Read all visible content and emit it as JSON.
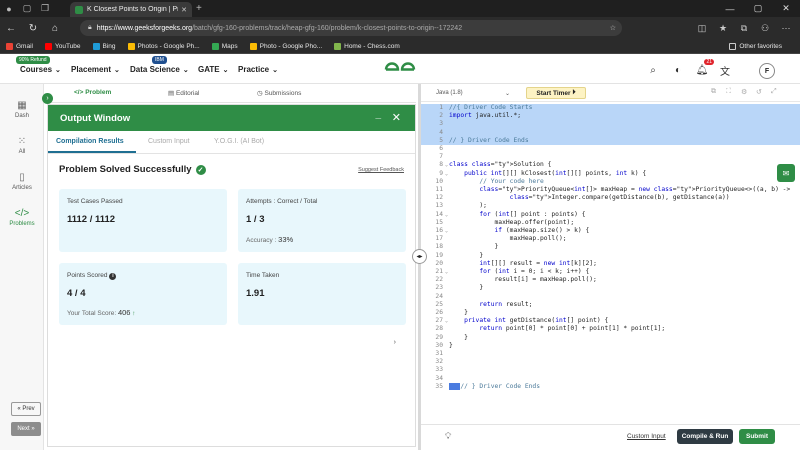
{
  "browser": {
    "tab_title": "K Closest Points to Origin | Practic",
    "url_host": "https://www.geeksforgeeks.org",
    "url_path": "/batch/gfg-160-problems/track/heap-gfg-160/problem/k-closest-points-to-origin--172242",
    "bookmarks": [
      {
        "label": "Gmail",
        "color": "#ea4335"
      },
      {
        "label": "YouTube",
        "color": "#ff0000"
      },
      {
        "label": "Bing",
        "color": "#1f9bd7"
      },
      {
        "label": "Photos - Google Ph...",
        "color": "#fbbc05"
      },
      {
        "label": "Maps",
        "color": "#34a853"
      },
      {
        "label": "Photo - Google Pho...",
        "color": "#fbbc05"
      },
      {
        "label": "Home - Chess.com",
        "color": "#81b64c"
      }
    ],
    "other_favorites": "Other favorites"
  },
  "header": {
    "courses": "Courses",
    "courses_badge": "90% Refund",
    "placement": "Placement",
    "data_science": "Data Science",
    "data_science_badge": "IBM",
    "gate": "GATE",
    "practice": "Practice",
    "notification_count": "21",
    "avatar_letter": "F"
  },
  "sidebar": {
    "items": [
      "Dash",
      "All",
      "Articles",
      "Problems"
    ],
    "prev": "« Prev",
    "next": "Next »"
  },
  "problem_tabs": [
    "Problem",
    "Editorial",
    "Submissions"
  ],
  "output": {
    "title": "Output Window",
    "tabs": [
      "Compilation Results",
      "Custom Input",
      "Y.O.G.I. (AI Bot)"
    ],
    "status": "Problem Solved Successfully",
    "suggest": "Suggest Feedback",
    "test_cases_label": "Test Cases Passed",
    "test_cases_value": "1112 / 1112",
    "attempts_label": "Attempts : Correct / Total",
    "attempts_value": "1 / 3",
    "accuracy_label": "Accuracy :",
    "accuracy_value": "33%",
    "points_label": "Points Scored",
    "points_value": "4 / 4",
    "total_score_label": "Your Total Score:",
    "total_score_value": "406",
    "time_label": "Time Taken",
    "time_value": "1.91"
  },
  "editor": {
    "language": "Java (1.8)",
    "timer": "Start Timer",
    "lines": [
      "//{ Driver Code Starts",
      "import java.util.*;",
      "",
      "",
      "// } Driver Code Ends",
      "",
      "",
      "class Solution {",
      "    public int[][] kClosest(int[][] points, int k) {",
      "        // Your code here",
      "        PriorityQueue<int[]> maxHeap = new PriorityQueue<>((a, b) ->",
      "                Integer.compare(getDistance(b), getDistance(a))",
      "        );",
      "        for (int[] point : points) {",
      "            maxHeap.offer(point);",
      "            if (maxHeap.size() > k) {",
      "                maxHeap.poll();",
      "            }",
      "        }",
      "        int[][] result = new int[k][2];",
      "        for (int i = 0; i < k; i++) {",
      "            result[i] = maxHeap.poll();",
      "        }",
      "",
      "        return result;",
      "    }",
      "    private int getDistance(int[] point) {",
      "        return point[0] * point[0] + point[1] * point[1];",
      "    }",
      "}",
      "",
      "",
      "",
      "",
      "// } Driver Code Ends"
    ]
  },
  "bottom": {
    "custom_input": "Custom Input",
    "compile_run": "Compile & Run",
    "submit": "Submit"
  },
  "colors": {
    "brand_green": "#2f8d46",
    "highlight": "#b9d6f8",
    "card_bg": "#e8f7fc",
    "tab_active": "#1f6f92"
  }
}
